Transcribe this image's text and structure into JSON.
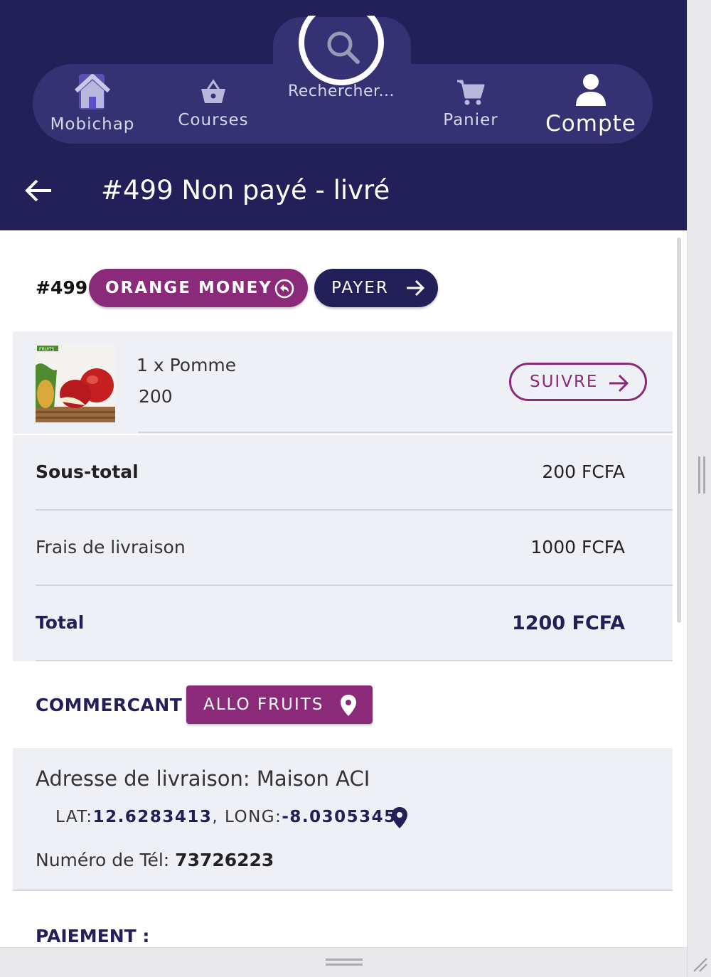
{
  "nav": {
    "home_label": "Mobichap",
    "courses_label": "Courses",
    "search_label": "Rechercher...",
    "panier_label": "Panier",
    "compte_label": "Compte"
  },
  "header": {
    "title": "#499 Non payé - livré"
  },
  "order": {
    "id": "#499",
    "payment_method": "ORANGE MONEY",
    "pay_label": "PAYER"
  },
  "product": {
    "quantity_name": "1 x Pomme",
    "price": "200",
    "track_label": "SUIVRE",
    "image_icon": "apple-fruit-basket-image"
  },
  "totals": {
    "subtotal_label": "Sous-total",
    "subtotal_value": "200 FCFA",
    "delivery_label": "Frais de livraison",
    "delivery_value": "1000 FCFA",
    "total_label": "Total",
    "total_value": "1200 FCFA"
  },
  "merchant": {
    "label": "COMMERCANT :",
    "name": "ALLO FRUITS"
  },
  "delivery": {
    "address": "Adresse de livraison: Maison ACI",
    "lat_label": "LAT:",
    "lat_value": "12.6283413",
    "sep": ", ",
    "long_label": "LONG:",
    "long_value": "-8.0305345",
    "phone_label": "Numéro de Tél: ",
    "phone_value": "73726223"
  },
  "payment": {
    "label": "PAIEMENT :"
  },
  "colors": {
    "header_bg": "#232059",
    "nav_pill": "#353273",
    "accent_purple": "#8b2a78",
    "navy": "#232059",
    "grey_block": "#eff0f6"
  }
}
